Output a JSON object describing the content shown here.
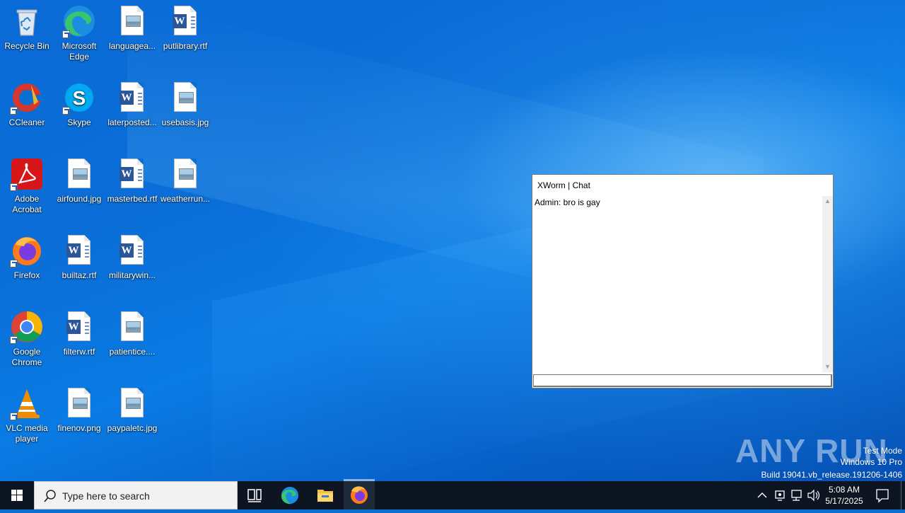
{
  "desktop": {
    "icons": [
      {
        "label": "Recycle Bin",
        "icon": "recycle-bin-icon"
      },
      {
        "label": "Microsoft Edge",
        "icon": "edge-icon"
      },
      {
        "label": "languagea...",
        "icon": "image-file-icon"
      },
      {
        "label": "putlibrary.rtf",
        "icon": "word-file-icon"
      },
      {
        "label": "CCleaner",
        "icon": "ccleaner-icon"
      },
      {
        "label": "Skype",
        "icon": "skype-icon"
      },
      {
        "label": "laterposted...",
        "icon": "word-file-icon"
      },
      {
        "label": "usebasis.jpg",
        "icon": "image-file-icon"
      },
      {
        "label": "Adobe Acrobat",
        "icon": "acrobat-icon"
      },
      {
        "label": "airfound.jpg",
        "icon": "image-file-icon"
      },
      {
        "label": "masterbed.rtf",
        "icon": "word-file-icon"
      },
      {
        "label": "weatherrun...",
        "icon": "image-file-icon"
      },
      {
        "label": "Firefox",
        "icon": "firefox-icon"
      },
      {
        "label": "builtaz.rtf",
        "icon": "word-file-icon"
      },
      {
        "label": "militarywin...",
        "icon": "word-file-icon"
      },
      {
        "label": "Google Chrome",
        "icon": "chrome-icon"
      },
      {
        "label": "filterw.rtf",
        "icon": "word-file-icon"
      },
      {
        "label": "patientice....",
        "icon": "image-file-icon"
      },
      {
        "label": "VLC media player",
        "icon": "vlc-icon"
      },
      {
        "label": "finenov.png",
        "icon": "image-file-icon"
      },
      {
        "label": "paypaletc.jpg",
        "icon": "image-file-icon"
      }
    ]
  },
  "chat_window": {
    "title": "XWorm | Chat",
    "messages": [
      "Admin: bro is gay"
    ],
    "input_value": ""
  },
  "watermark": {
    "logo": "ANY RUN",
    "line1": "Test Mode",
    "line2": "Windows 10 Pro",
    "line3": "Build 19041.vb_release.191206-1406"
  },
  "taskbar": {
    "search_placeholder": "Type here to search",
    "pinned": [
      "task-view-icon",
      "edge-icon",
      "file-explorer-icon",
      "firefox-icon"
    ],
    "time": "5:08 AM",
    "date": "5/17/2025"
  },
  "colors": {
    "desktop_blue": "#0a6fd1",
    "taskbar": "#0c1521",
    "word_blue": "#2b579a"
  }
}
